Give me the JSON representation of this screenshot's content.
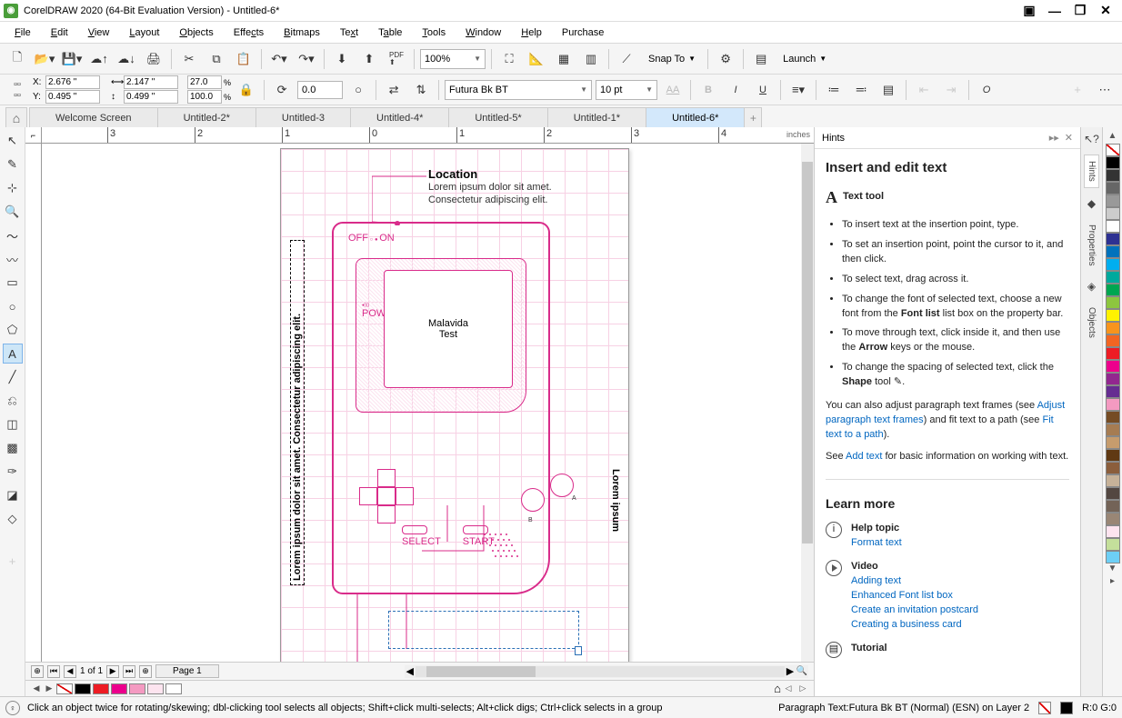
{
  "titlebar": {
    "title": "CorelDRAW 2020 (64-Bit Evaluation Version) - Untitled-6*"
  },
  "menu": [
    "File",
    "Edit",
    "View",
    "Layout",
    "Objects",
    "Effects",
    "Bitmaps",
    "Text",
    "Table",
    "Tools",
    "Window",
    "Help",
    "Purchase"
  ],
  "toolbar1": {
    "zoom": "100%",
    "snap": "Snap To",
    "launch": "Launch"
  },
  "propbar": {
    "x": "2.676 \"",
    "y": "0.495 \"",
    "w": "2.147 \"",
    "h": "0.499 \"",
    "sx": "27.0",
    "sy": "100.0",
    "angle": "0.0",
    "font": "Futura Bk BT",
    "size": "10 pt"
  },
  "tabs": [
    "Welcome Screen",
    "Untitled-2*",
    "Untitled-3",
    "Untitled-4*",
    "Untitled-5*",
    "Untitled-1*",
    "Untitled-6*"
  ],
  "active_tab": 6,
  "ruler_unit": "inches",
  "canvas": {
    "location_h": "Location",
    "location_t1": "Lorem ipsum dolor sit amet.",
    "location_t2": "Consectetur adipiscing elit.",
    "screen_l1": "Malavida",
    "screen_l2": "Test",
    "off": "OFF",
    "on": "ON",
    "power": "POWER",
    "select": "SELECT",
    "start": "START",
    "a": "A",
    "b": "B",
    "sidetext": "Lorem ipsum dolor sit amet. Consectetur adipiscing elit.",
    "rtext": "Lorem ipsum"
  },
  "page_nav": {
    "label": "1 of 1",
    "page": "Page 1"
  },
  "hints": {
    "title": "Hints",
    "h": "Insert and edit text",
    "tool": "Text tool",
    "bullets": [
      "To insert text at the insertion point, type.",
      "To set an insertion point, point the cursor to it, and then click.",
      "To select text, drag across it.",
      "To change the font of selected text, choose a new font from the Font list list box on the property bar.",
      "To move through text, click inside it, and then use the Arrow keys or the mouse.",
      "To change the spacing of selected text, click the Shape tool ."
    ],
    "para1a": "You can also adjust paragraph text frames (see ",
    "para1link1": "Adjust paragraph text frames",
    "para1b": ") and fit text to a path (see ",
    "para1link2": "Fit text to a path",
    "para1c": ").",
    "para2a": "See ",
    "para2link": "Add text",
    "para2b": " for basic information on working with text.",
    "learn": "Learn more",
    "help_h": "Help topic",
    "help_link": "Format text",
    "video_h": "Video",
    "video_links": [
      "Adding text",
      "Enhanced Font list box",
      "Create an invitation postcard",
      "Creating a business card"
    ],
    "tutorial": "Tutorial"
  },
  "dock": [
    "Hints",
    "Properties",
    "Objects"
  ],
  "palette_colors": [
    "#000000",
    "#202020",
    "#ffffff",
    "#dddddd",
    "#bbbbbb",
    "#888888",
    "#555555",
    "#00a99d",
    "#00aeef",
    "#0072bc",
    "#2e3192",
    "#662d91",
    "#92278f",
    "#ec008c",
    "#ed1c24",
    "#f26522",
    "#f7941d",
    "#fff200",
    "#8dc63f",
    "#00a651",
    "#a67c52",
    "#754c24"
  ],
  "bottom_swatches": [
    "#000000",
    "#ed1c24",
    "#ec008c",
    "#f49ac1",
    "#fde4ef",
    "#ffffff"
  ],
  "status": {
    "msg": "Click an object twice for rotating/skewing; dbl-clicking tool selects all objects; Shift+click multi-selects; Alt+click digs; Ctrl+click selects in a group",
    "obj": "Paragraph Text:Futura Bk BT (Normal) (ESN) on Layer 2",
    "rgb": "R:0 G:0"
  }
}
